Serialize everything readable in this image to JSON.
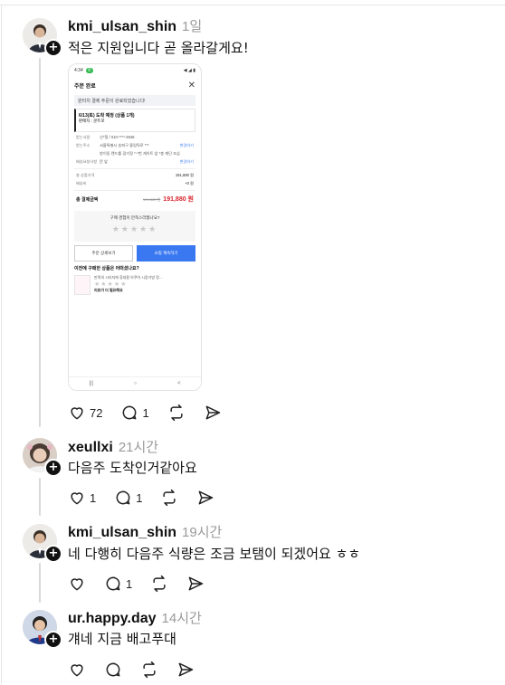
{
  "posts": [
    {
      "username": "kmi_ulsan_shin",
      "time": "1일",
      "text": "적은 지원입니다 곧 올라갈게요!",
      "likes": "72",
      "replies": "1"
    },
    {
      "username": "xeullxi",
      "time": "21시간",
      "text": "다음주 도착인거같아요",
      "likes": "1",
      "replies": "1"
    },
    {
      "username": "kmi_ulsan_shin",
      "time": "19시간",
      "text": "네 다행히 다음주 식량은 조금 보탬이 되겠어요 ㅎㅎ",
      "likes": "",
      "replies": "1"
    },
    {
      "username": "ur.happy.day",
      "time": "14시간",
      "text": "걔네 지금 배고푸대",
      "likes": "",
      "replies": ""
    }
  ],
  "phone": {
    "status_time": "4:34",
    "status_right": "◀ ◢ ▮",
    "header_title": "주문 완료",
    "close": "✕",
    "banner": "원터치 결제 주문이 완료되었습니다!",
    "delivery_title": "6/13(토) 도착 예정 (상품 1개)",
    "delivery_seller": "판매자 : 쿤트포",
    "rows": [
      {
        "k": "받는사람",
        "v": "신*철 / 010-****-3948",
        "r": ""
      },
      {
        "k": "받는주소",
        "v": "서울특별시 송파구 올림픽로 ***",
        "r": "변경하기"
      },
      {
        "k": "",
        "v": "방이동 캔드롤 광기정 *-*번 게이트 앞 *층 계단 조심",
        "r": ""
      },
      {
        "k": "배송요청사항",
        "v": "문 앞",
        "r": "변경하기"
      }
    ],
    "price_rows": [
      {
        "k": "총 상품가격",
        "r": "191,880 원"
      },
      {
        "k": "배송비",
        "r": "+0 원"
      }
    ],
    "total_label": "총 결제금액",
    "total_old": "191,880 원",
    "total_amount": "191,880 원",
    "rate_question": "구매 경험이 만족스러웠나요?",
    "stars": "★★★★★",
    "btn_detail": "주문 상세보기",
    "btn_continue": "쇼핑 계속하기",
    "section_title": "이전에 구매한 상품은 어떠셨나요?",
    "product_name": "만족의 시티지에 휴대용 아쿠아 시장가방 정...",
    "review_prompt": "리뷰가 더 필요해요",
    "nav": [
      "|||",
      "○",
      "<"
    ]
  }
}
